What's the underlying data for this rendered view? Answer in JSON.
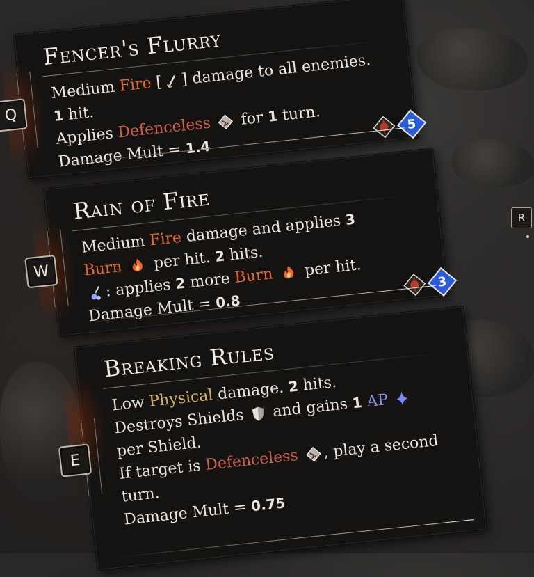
{
  "abilities": [
    {
      "key": "Q",
      "title": "Fencer's Flurry",
      "line1_a": "Medium",
      "line1_fire": "Fire",
      "line1_b": "[",
      "line1_c": "] damage to all enemies.",
      "line2_num": "1",
      "line2_text": "hit.",
      "line3_a": "Applies",
      "line3_debuff": "Defenceless",
      "line3_b": "for",
      "line3_num": "1",
      "line3_c": "turn.",
      "mult_label": "Damage Mult =",
      "mult_value": "1.4",
      "cost": "5"
    },
    {
      "key": "W",
      "title": "Rain of Fire",
      "line1_a": "Medium",
      "line1_fire": "Fire",
      "line1_b": "damage and applies",
      "line1_num": "3",
      "line2_burn": "Burn",
      "line2_a": "per hit.",
      "line2_num": "2",
      "line2_b": "hits.",
      "line3_a": ": applies",
      "line3_num": "2",
      "line3_b": "more",
      "line3_burn": "Burn",
      "line3_c": "per hit.",
      "mult_label": "Damage Mult =",
      "mult_value": "0.8",
      "cost": "3"
    },
    {
      "key": "E",
      "title": "Breaking Rules",
      "line1_a": "Low",
      "line1_phys": "Physical",
      "line1_b": "damage.",
      "line1_num": "2",
      "line1_c": "hits.",
      "line2_a": "Destroys Shields",
      "line2_b": "and gains",
      "line2_num": "1",
      "line2_ap": "AP",
      "line3": "per Shield.",
      "line4_a": "If target is",
      "line4_debuff": "Defenceless",
      "line4_b": ", play a second",
      "line5": "turn.",
      "mult_label": "Damage Mult =",
      "mult_value": "0.75"
    }
  ],
  "side_key": "R",
  "icons": {
    "sword": "sword-icon",
    "defenceless": "cracked-gem-icon",
    "burn": "flame-icon",
    "frost": "frost-icon",
    "shield": "shield-icon",
    "ap": "ap-diamond-icon",
    "target": "target-reticle-icon"
  },
  "colors": {
    "fire": "#e46a2b",
    "debuff": "#cf5e48",
    "physical": "#d3b15a",
    "ap": "#8a8df0",
    "cost": "#2a5bd8"
  }
}
